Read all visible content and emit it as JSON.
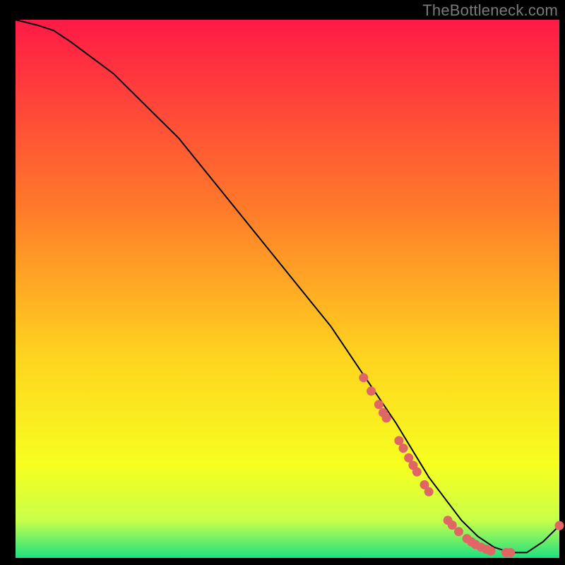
{
  "watermark": "TheBottleneck.com",
  "colors": {
    "bg_top": "#ff1a46",
    "bg_mid1": "#ff7a2a",
    "bg_mid2": "#ffd21f",
    "bg_mid3": "#f6ff1f",
    "bg_low": "#c8ff4a",
    "bg_bottom": "#1fe07f",
    "line": "#000000",
    "marker": "#e06666"
  },
  "chart_data": {
    "type": "line",
    "title": "",
    "xlabel": "",
    "ylabel": "",
    "xlim": [
      0,
      100
    ],
    "ylim": [
      0,
      100
    ],
    "series": [
      {
        "name": "curve",
        "x": [
          0,
          4,
          7,
          10,
          14,
          18,
          22,
          26,
          30,
          34,
          38,
          42,
          46,
          50,
          54,
          58,
          62,
          66,
          70,
          73,
          76,
          79,
          82,
          85,
          88,
          91,
          94,
          97,
          100
        ],
        "y": [
          100,
          99,
          98,
          96,
          93,
          90,
          86,
          82,
          78,
          73,
          68,
          63,
          58,
          53,
          48,
          43,
          37,
          31,
          25,
          20,
          15,
          11,
          7,
          4,
          2,
          1,
          1,
          3,
          6
        ]
      }
    ],
    "markers": {
      "name": "dotted-segment",
      "x": [
        64.0,
        65.4,
        66.8,
        67.6,
        68.2,
        70.5,
        71.3,
        72.3,
        73.1,
        73.8,
        75.2,
        76.0,
        79.5,
        80.3,
        81.5,
        83.0,
        83.8,
        84.6,
        85.6,
        86.6,
        87.4,
        90.2,
        91.0,
        100.0
      ],
      "y": [
        33.5,
        31.0,
        28.5,
        27.0,
        26.0,
        21.8,
        20.4,
        18.6,
        17.2,
        16.0,
        13.6,
        12.3,
        7.0,
        6.1,
        4.9,
        3.6,
        3.0,
        2.5,
        2.0,
        1.6,
        1.3,
        1.0,
        1.0,
        6.0
      ]
    }
  }
}
